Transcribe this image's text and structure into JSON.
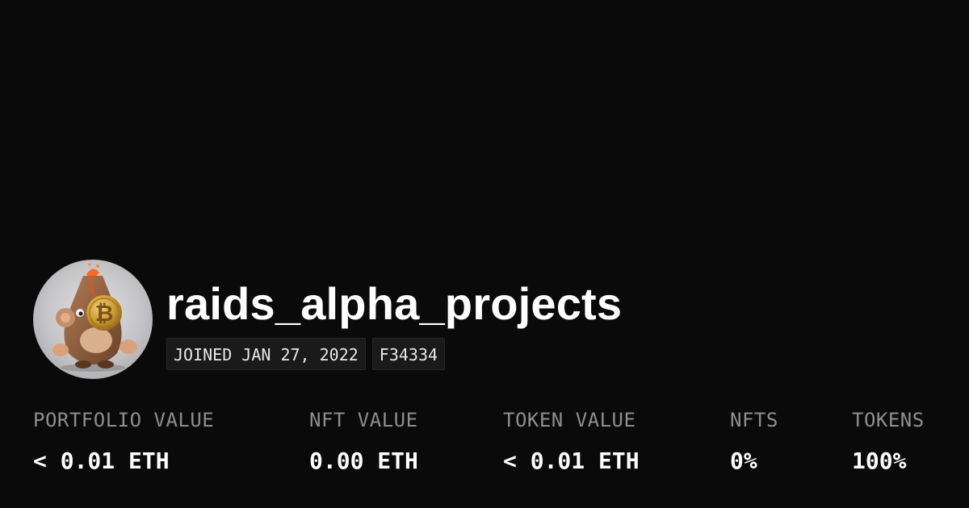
{
  "profile": {
    "avatar_icon": "volcano-creature-bitcoin-avatar",
    "username": "raids_alpha_projects",
    "joined": "JOINED JAN 27, 2022",
    "color_code": "F34334"
  },
  "stats": [
    {
      "label": "PORTFOLIO VALUE",
      "value": "< 0.01 ETH"
    },
    {
      "label": "NFT VALUE",
      "value": "0.00 ETH"
    },
    {
      "label": "TOKEN VALUE",
      "value": "< 0.01 ETH"
    },
    {
      "label": "NFTS",
      "value": "0%"
    },
    {
      "label": "TOKENS",
      "value": "100%"
    }
  ],
  "colors": {
    "background": "#0a0a0a",
    "text": "#ffffff",
    "muted_label": "#8e8e8e",
    "badge_background": "#1a1a1a"
  }
}
